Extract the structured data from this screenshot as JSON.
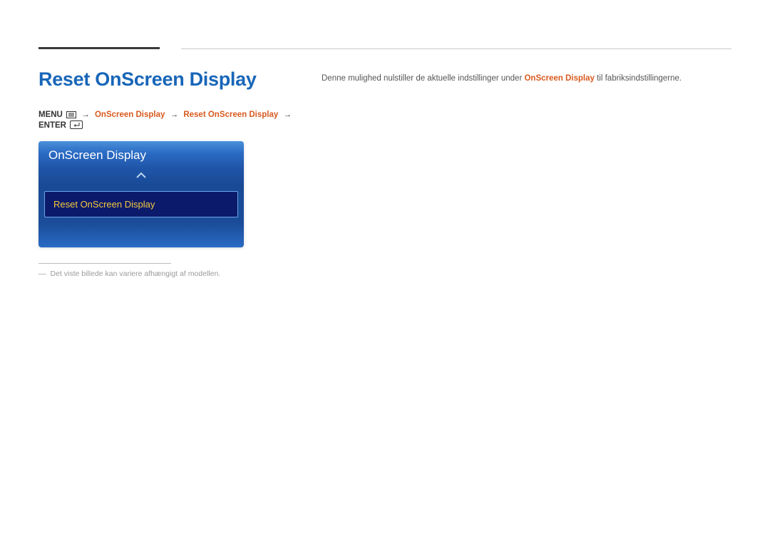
{
  "title": "Reset OnScreen Display",
  "breadcrumb": {
    "menu_label": "MENU",
    "step1": "OnScreen Display",
    "step2": "Reset OnScreen Display",
    "enter_label": "ENTER",
    "arrow": "→"
  },
  "osd_panel": {
    "header": "OnScreen Display",
    "selected_item": "Reset OnScreen Display"
  },
  "footnote": {
    "dash": "―",
    "text": "Det viste billede kan variere afhængigt af modellen."
  },
  "description": {
    "pre": "Denne mulighed nulstiller de aktuelle indstillinger under ",
    "highlight": "OnScreen Display",
    "post": " til fabriksindstillingerne."
  }
}
